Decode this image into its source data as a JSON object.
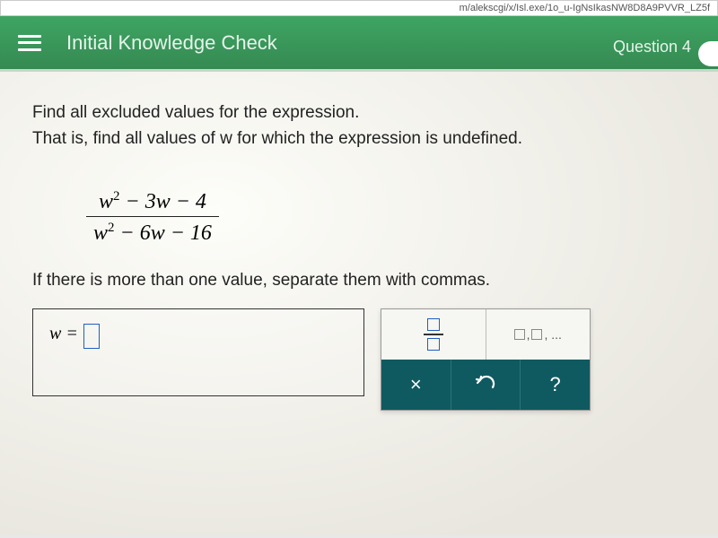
{
  "url_bar": "m/alekscgi/x/Isl.exe/1o_u-IgNsIkasNW8D8A9PVVR_LZ5f",
  "header": {
    "title": "Initial Knowledge Check",
    "question_label": "Question 4"
  },
  "problem": {
    "line1": "Find all excluded values for the expression.",
    "line2": "That is, find all values of w for which the expression is undefined.",
    "numerator": "w² − 3w − 4",
    "denominator": "w² − 6w − 16",
    "instruction": "If there is more than one value, separate them with commas."
  },
  "answer": {
    "prefix": "w = ",
    "value": ""
  },
  "tools": {
    "fraction_label": "fraction",
    "list_label": "□, □, ...",
    "clear_label": "×",
    "undo_label": "↶",
    "help_label": "?"
  },
  "chart_data": {
    "type": "table",
    "title": "Rational expression excluded values",
    "expression": "(w^2 - 3w - 4) / (w^2 - 6w - 16)"
  }
}
